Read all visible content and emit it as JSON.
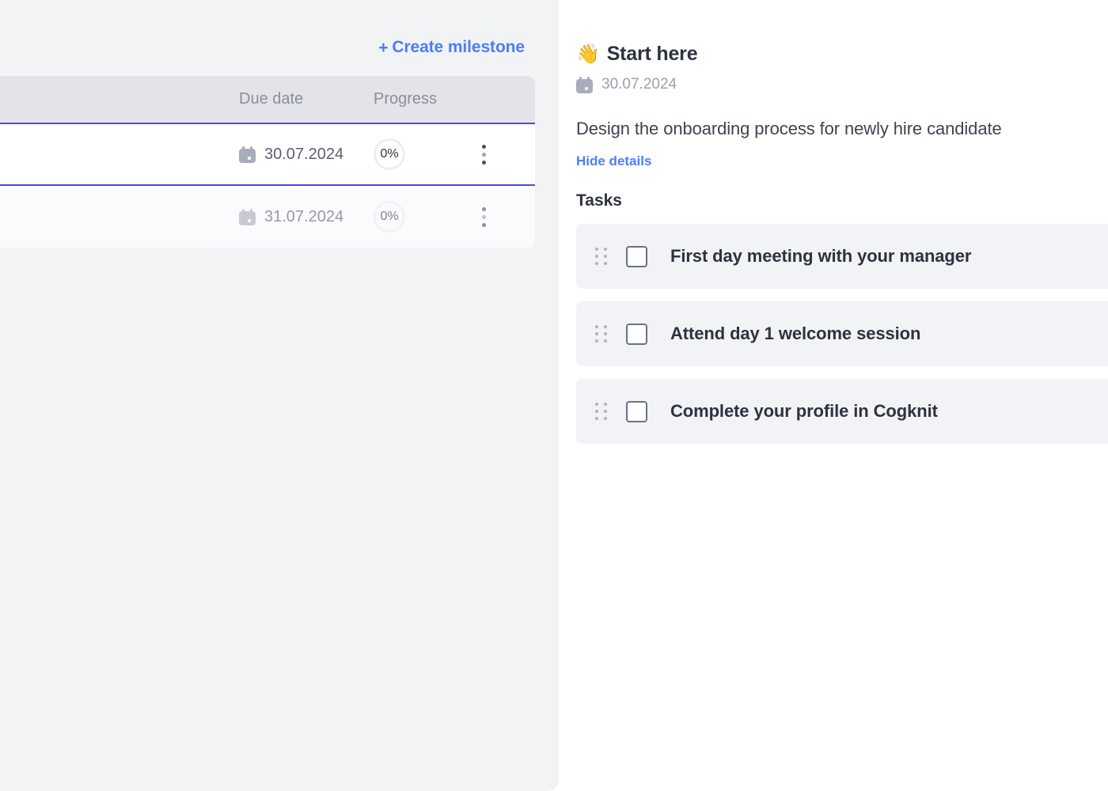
{
  "left": {
    "create_milestone_label": "Create milestone",
    "plus_symbol": "+",
    "table": {
      "columns": {
        "name": "",
        "due_date": "Due date",
        "progress": "Progress"
      },
      "rows": [
        {
          "name": "",
          "due_date": "30.07.2024",
          "progress": "0%",
          "selected": true
        },
        {
          "name": "",
          "due_date": "31.07.2024",
          "progress": "0%",
          "selected": false
        }
      ]
    }
  },
  "right": {
    "emoji": "👋",
    "title": "Start here",
    "date": "30.07.2024",
    "description": "Design the onboarding process for newly hire candidate",
    "hide_details_label": "Hide details",
    "tasks_heading": "Tasks",
    "tasks": [
      {
        "label": "First day meeting with your manager",
        "checked": false
      },
      {
        "label": "Attend day 1 welcome session",
        "checked": false
      },
      {
        "label": "Complete your profile in Cogknit",
        "checked": false
      }
    ]
  },
  "colors": {
    "accent_blue": "#4f7df4",
    "selection_border": "#4f46e5",
    "panel_bg": "#f1f3f5",
    "row_bg": "#fafbfc",
    "header_bg": "#e2e4e9",
    "task_row_bg": "#f2f3f6",
    "text_primary": "#2d3240",
    "text_muted": "#9aa0ad"
  }
}
